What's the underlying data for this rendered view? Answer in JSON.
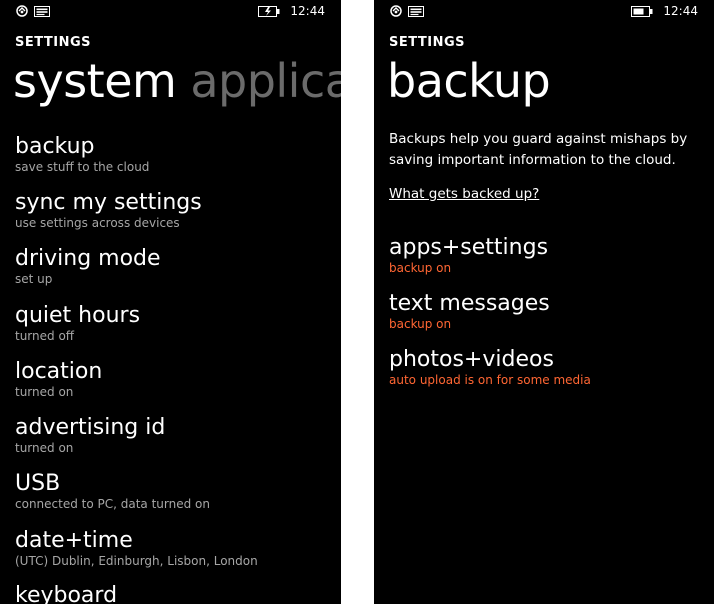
{
  "status_bar": {
    "time": "12:44"
  },
  "left_screen": {
    "section_title": "SETTINGS",
    "pivot_active": "system",
    "pivot_inactive": "applications",
    "items": [
      {
        "title": "backup",
        "subtitle": "save stuff to the cloud"
      },
      {
        "title": "sync my settings",
        "subtitle": "use settings across devices"
      },
      {
        "title": "driving mode",
        "subtitle": "set up"
      },
      {
        "title": "quiet hours",
        "subtitle": "turned off"
      },
      {
        "title": "location",
        "subtitle": "turned on"
      },
      {
        "title": "advertising id",
        "subtitle": "turned on"
      },
      {
        "title": "USB",
        "subtitle": "connected to PC, data turned on"
      },
      {
        "title": "date+time",
        "subtitle": "(UTC) Dublin, Edinburgh, Lisbon, London"
      },
      {
        "title": "keyboard",
        "subtitle": ""
      }
    ]
  },
  "right_screen": {
    "section_title": "SETTINGS",
    "page_title": "backup",
    "description": "Backups help you guard against mishaps by saving important information to the cloud.",
    "link_text": "What gets backed up?",
    "items": [
      {
        "title": "apps+settings",
        "subtitle": "backup on"
      },
      {
        "title": "text messages",
        "subtitle": "backup on"
      },
      {
        "title": "photos+videos",
        "subtitle": "auto upload is on for some media"
      }
    ],
    "accent_color": "#ff6633"
  }
}
